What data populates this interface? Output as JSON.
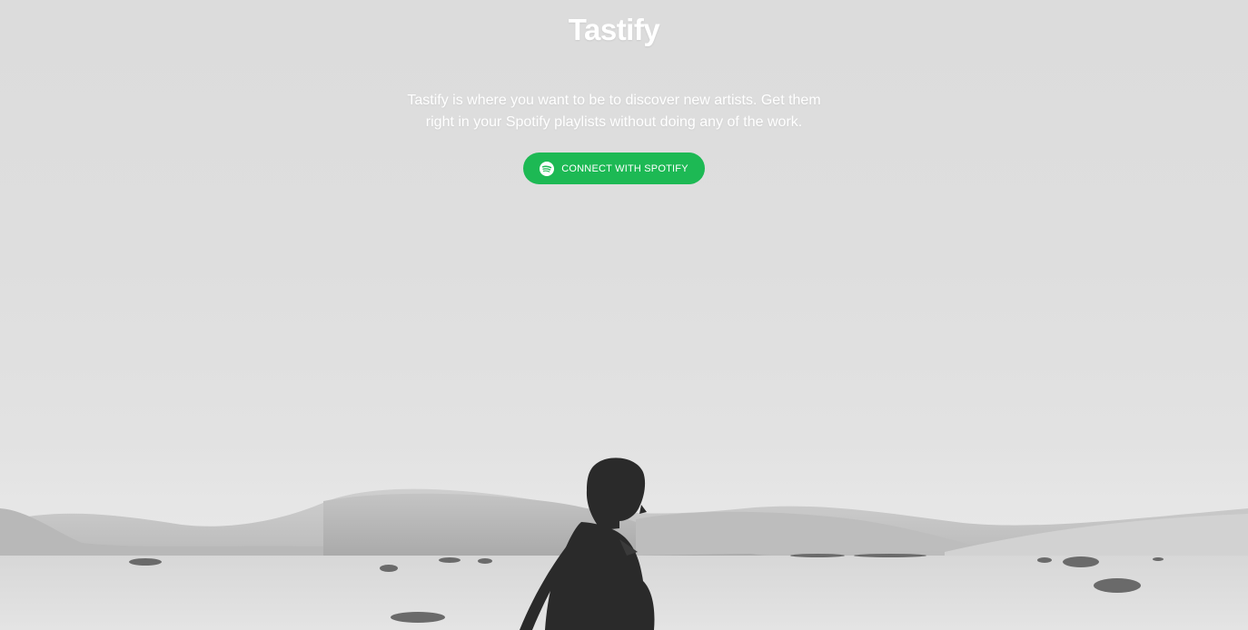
{
  "app": {
    "title": "Tastify",
    "tagline": "Tastify is where you want to be to discover new artists. Get them right in your Spotify playlists without doing any of the work."
  },
  "cta": {
    "label": "CONNECT WITH SPOTIFY",
    "icon": "spotify-icon"
  },
  "colors": {
    "accent": "#1db954",
    "text": "#ffffff",
    "background": "#dedede",
    "silhouette": "#2a2a2a"
  }
}
